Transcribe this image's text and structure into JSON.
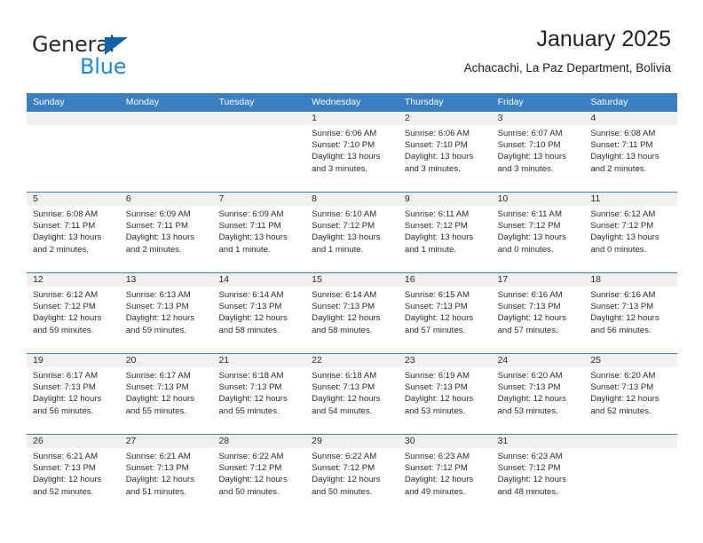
{
  "brand": {
    "word_one": "General",
    "word_two": "Blue",
    "triangle_icon": "brand-triangle-icon",
    "accent_blue": "#1f87dd",
    "accent_dark_blue": "#1162ad"
  },
  "header": {
    "title": "January 2025",
    "subtitle": "Achacachi, La Paz Department, Bolivia"
  },
  "theme": {
    "header_blue": "#3a7fc1",
    "day_band_gray": "#f0f0f0",
    "text_color": "#2b2b2b"
  },
  "weekday_headers": [
    "Sunday",
    "Monday",
    "Tuesday",
    "Wednesday",
    "Thursday",
    "Friday",
    "Saturday"
  ],
  "weeks": [
    [
      {
        "day": "",
        "sunrise": "",
        "sunset": "",
        "daylight": "",
        "empty": true
      },
      {
        "day": "",
        "sunrise": "",
        "sunset": "",
        "daylight": "",
        "empty": true
      },
      {
        "day": "",
        "sunrise": "",
        "sunset": "",
        "daylight": "",
        "empty": true
      },
      {
        "day": "1",
        "sunrise": "Sunrise: 6:06 AM",
        "sunset": "Sunset: 7:10 PM",
        "daylight": "Daylight: 13 hours and 3 minutes.",
        "empty": false
      },
      {
        "day": "2",
        "sunrise": "Sunrise: 6:06 AM",
        "sunset": "Sunset: 7:10 PM",
        "daylight": "Daylight: 13 hours and 3 minutes.",
        "empty": false
      },
      {
        "day": "3",
        "sunrise": "Sunrise: 6:07 AM",
        "sunset": "Sunset: 7:10 PM",
        "daylight": "Daylight: 13 hours and 3 minutes.",
        "empty": false
      },
      {
        "day": "4",
        "sunrise": "Sunrise: 6:08 AM",
        "sunset": "Sunset: 7:11 PM",
        "daylight": "Daylight: 13 hours and 2 minutes.",
        "empty": false
      }
    ],
    [
      {
        "day": "5",
        "sunrise": "Sunrise: 6:08 AM",
        "sunset": "Sunset: 7:11 PM",
        "daylight": "Daylight: 13 hours and 2 minutes.",
        "empty": false
      },
      {
        "day": "6",
        "sunrise": "Sunrise: 6:09 AM",
        "sunset": "Sunset: 7:11 PM",
        "daylight": "Daylight: 13 hours and 2 minutes.",
        "empty": false
      },
      {
        "day": "7",
        "sunrise": "Sunrise: 6:09 AM",
        "sunset": "Sunset: 7:11 PM",
        "daylight": "Daylight: 13 hours and 1 minute.",
        "empty": false
      },
      {
        "day": "8",
        "sunrise": "Sunrise: 6:10 AM",
        "sunset": "Sunset: 7:12 PM",
        "daylight": "Daylight: 13 hours and 1 minute.",
        "empty": false
      },
      {
        "day": "9",
        "sunrise": "Sunrise: 6:11 AM",
        "sunset": "Sunset: 7:12 PM",
        "daylight": "Daylight: 13 hours and 1 minute.",
        "empty": false
      },
      {
        "day": "10",
        "sunrise": "Sunrise: 6:11 AM",
        "sunset": "Sunset: 7:12 PM",
        "daylight": "Daylight: 13 hours and 0 minutes.",
        "empty": false
      },
      {
        "day": "11",
        "sunrise": "Sunrise: 6:12 AM",
        "sunset": "Sunset: 7:12 PM",
        "daylight": "Daylight: 13 hours and 0 minutes.",
        "empty": false
      }
    ],
    [
      {
        "day": "12",
        "sunrise": "Sunrise: 6:12 AM",
        "sunset": "Sunset: 7:12 PM",
        "daylight": "Daylight: 12 hours and 59 minutes.",
        "empty": false
      },
      {
        "day": "13",
        "sunrise": "Sunrise: 6:13 AM",
        "sunset": "Sunset: 7:13 PM",
        "daylight": "Daylight: 12 hours and 59 minutes.",
        "empty": false
      },
      {
        "day": "14",
        "sunrise": "Sunrise: 6:14 AM",
        "sunset": "Sunset: 7:13 PM",
        "daylight": "Daylight: 12 hours and 58 minutes.",
        "empty": false
      },
      {
        "day": "15",
        "sunrise": "Sunrise: 6:14 AM",
        "sunset": "Sunset: 7:13 PM",
        "daylight": "Daylight: 12 hours and 58 minutes.",
        "empty": false
      },
      {
        "day": "16",
        "sunrise": "Sunrise: 6:15 AM",
        "sunset": "Sunset: 7:13 PM",
        "daylight": "Daylight: 12 hours and 57 minutes.",
        "empty": false
      },
      {
        "day": "17",
        "sunrise": "Sunrise: 6:16 AM",
        "sunset": "Sunset: 7:13 PM",
        "daylight": "Daylight: 12 hours and 57 minutes.",
        "empty": false
      },
      {
        "day": "18",
        "sunrise": "Sunrise: 6:16 AM",
        "sunset": "Sunset: 7:13 PM",
        "daylight": "Daylight: 12 hours and 56 minutes.",
        "empty": false
      }
    ],
    [
      {
        "day": "19",
        "sunrise": "Sunrise: 6:17 AM",
        "sunset": "Sunset: 7:13 PM",
        "daylight": "Daylight: 12 hours and 56 minutes.",
        "empty": false
      },
      {
        "day": "20",
        "sunrise": "Sunrise: 6:17 AM",
        "sunset": "Sunset: 7:13 PM",
        "daylight": "Daylight: 12 hours and 55 minutes.",
        "empty": false
      },
      {
        "day": "21",
        "sunrise": "Sunrise: 6:18 AM",
        "sunset": "Sunset: 7:13 PM",
        "daylight": "Daylight: 12 hours and 55 minutes.",
        "empty": false
      },
      {
        "day": "22",
        "sunrise": "Sunrise: 6:18 AM",
        "sunset": "Sunset: 7:13 PM",
        "daylight": "Daylight: 12 hours and 54 minutes.",
        "empty": false
      },
      {
        "day": "23",
        "sunrise": "Sunrise: 6:19 AM",
        "sunset": "Sunset: 7:13 PM",
        "daylight": "Daylight: 12 hours and 53 minutes.",
        "empty": false
      },
      {
        "day": "24",
        "sunrise": "Sunrise: 6:20 AM",
        "sunset": "Sunset: 7:13 PM",
        "daylight": "Daylight: 12 hours and 53 minutes.",
        "empty": false
      },
      {
        "day": "25",
        "sunrise": "Sunrise: 6:20 AM",
        "sunset": "Sunset: 7:13 PM",
        "daylight": "Daylight: 12 hours and 52 minutes.",
        "empty": false
      }
    ],
    [
      {
        "day": "26",
        "sunrise": "Sunrise: 6:21 AM",
        "sunset": "Sunset: 7:13 PM",
        "daylight": "Daylight: 12 hours and 52 minutes.",
        "empty": false
      },
      {
        "day": "27",
        "sunrise": "Sunrise: 6:21 AM",
        "sunset": "Sunset: 7:13 PM",
        "daylight": "Daylight: 12 hours and 51 minutes.",
        "empty": false
      },
      {
        "day": "28",
        "sunrise": "Sunrise: 6:22 AM",
        "sunset": "Sunset: 7:12 PM",
        "daylight": "Daylight: 12 hours and 50 minutes.",
        "empty": false
      },
      {
        "day": "29",
        "sunrise": "Sunrise: 6:22 AM",
        "sunset": "Sunset: 7:12 PM",
        "daylight": "Daylight: 12 hours and 50 minutes.",
        "empty": false
      },
      {
        "day": "30",
        "sunrise": "Sunrise: 6:23 AM",
        "sunset": "Sunset: 7:12 PM",
        "daylight": "Daylight: 12 hours and 49 minutes.",
        "empty": false
      },
      {
        "day": "31",
        "sunrise": "Sunrise: 6:23 AM",
        "sunset": "Sunset: 7:12 PM",
        "daylight": "Daylight: 12 hours and 48 minutes.",
        "empty": false
      },
      {
        "day": "",
        "sunrise": "",
        "sunset": "",
        "daylight": "",
        "empty": true
      }
    ]
  ]
}
